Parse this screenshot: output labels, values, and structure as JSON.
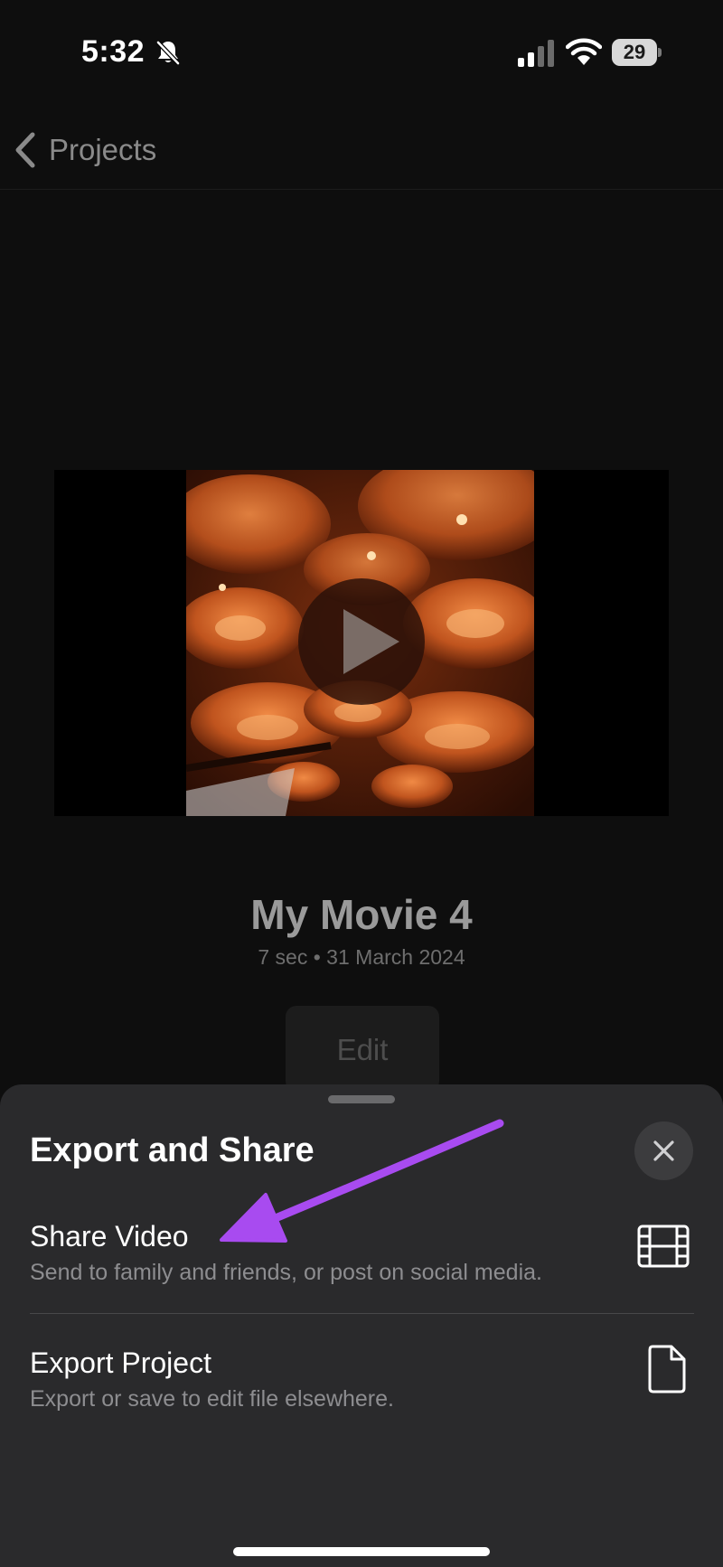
{
  "status_bar": {
    "time": "5:32",
    "battery_level": "29",
    "icons": [
      "bell-slash-icon",
      "cellular-signal-icon",
      "wifi-icon",
      "battery-icon"
    ]
  },
  "nav": {
    "back_label": "Projects"
  },
  "project": {
    "title": "My Movie 4",
    "meta": "7 sec • 31 March 2024",
    "edit_label": "Edit"
  },
  "sheet": {
    "title": "Export and Share",
    "items": [
      {
        "title": "Share Video",
        "subtitle": "Send to family and friends, or post on social media.",
        "icon": "film-icon"
      },
      {
        "title": "Export Project",
        "subtitle": "Export or save to edit file elsewhere.",
        "icon": "document-icon"
      }
    ]
  },
  "colors": {
    "background": "#0e0e0e",
    "sheet": "#2a2a2c",
    "annotation_arrow": "#a84bf0",
    "thumbnail_orange": "#c0541e"
  }
}
